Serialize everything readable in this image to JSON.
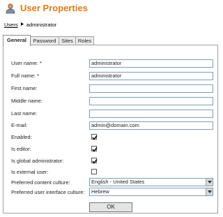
{
  "header": {
    "title": "User Properties",
    "icon": "user-icon"
  },
  "breadcrumb": {
    "link": "Users",
    "separator_icon": "triangle-right-icon",
    "current": "administrator"
  },
  "tabs": [
    {
      "label": "General",
      "active": true
    },
    {
      "label": "Password",
      "active": false
    },
    {
      "label": "Sites",
      "active": false
    },
    {
      "label": "Roles",
      "active": false
    }
  ],
  "form": {
    "username": {
      "label": "User name: *",
      "value": "administrator"
    },
    "fullname": {
      "label": "Full name: *",
      "value": "administrator"
    },
    "firstname": {
      "label": "First name:",
      "value": ""
    },
    "middlename": {
      "label": "Middle name:",
      "value": ""
    },
    "lastname": {
      "label": "Last name:",
      "value": ""
    },
    "email": {
      "label": "E-mail:",
      "value": "admin@domain.com"
    },
    "enabled": {
      "label": "Enabled:",
      "checked": true
    },
    "is_editor": {
      "label": "Is editor:",
      "checked": true
    },
    "is_global_admin": {
      "label": "Is global administrator:",
      "checked": true
    },
    "is_external": {
      "label": "Is external user:",
      "checked": false
    },
    "content_culture": {
      "label": "Preferred content culture:",
      "value": "English - United States"
    },
    "ui_culture": {
      "label": "Preferred user interface culture:",
      "value": "Hebrew"
    }
  },
  "ok_label": "OK",
  "colors": {
    "title": "#e07b12",
    "field_border": "#7f9db9",
    "panel_border": "#a0a0a0"
  }
}
